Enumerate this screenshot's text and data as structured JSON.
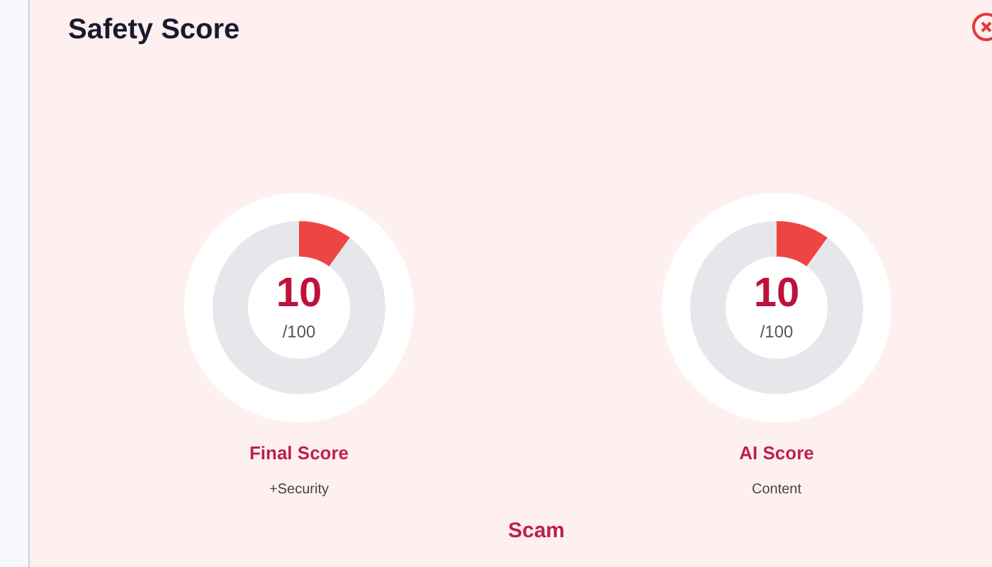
{
  "title": "Safety Score",
  "scores": [
    {
      "value": "10",
      "max": "/100",
      "label": "Final Score",
      "sublabel": "+Security"
    },
    {
      "value": "10",
      "max": "/100",
      "label": "AI Score",
      "sublabel": "Content"
    }
  ],
  "verdict": "Scam"
}
